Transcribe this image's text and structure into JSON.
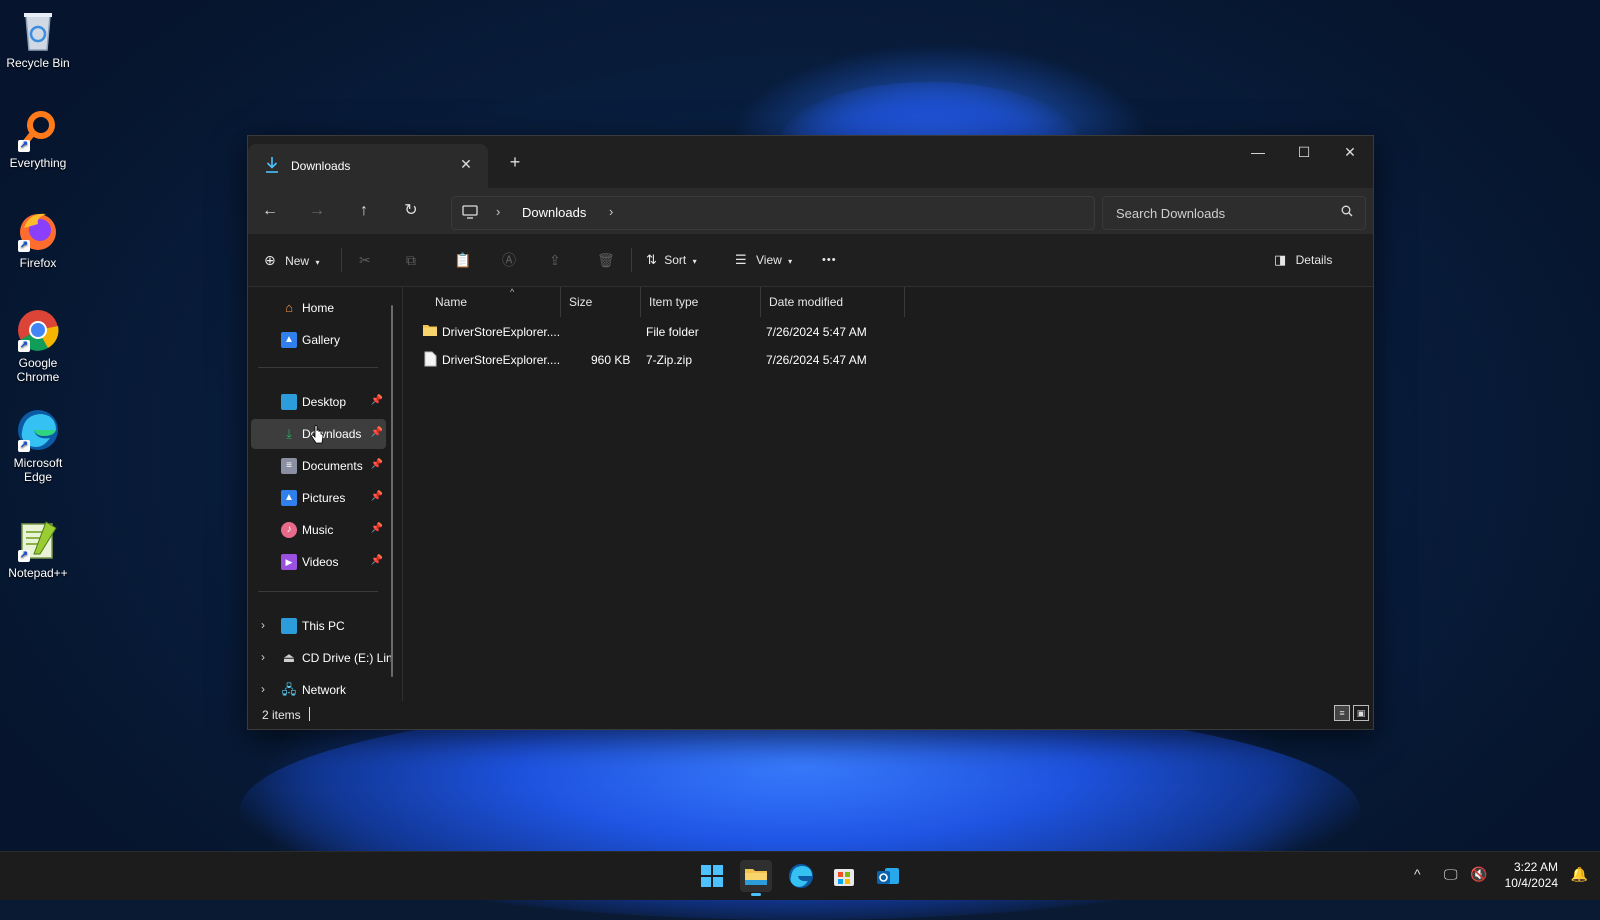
{
  "desktop": {
    "icons": [
      {
        "label": "Recycle Bin"
      },
      {
        "label": "Everything"
      },
      {
        "label": "Firefox"
      },
      {
        "label": "Google Chrome"
      },
      {
        "label": "Microsoft Edge"
      },
      {
        "label": "Notepad++"
      }
    ]
  },
  "window": {
    "tab_title": "Downloads",
    "address": {
      "crumb": "Downloads"
    },
    "search": {
      "placeholder": "Search Downloads"
    },
    "toolbar": {
      "new_label": "New",
      "sort_label": "Sort",
      "view_label": "View",
      "more_label": "•••",
      "details_label": "Details"
    },
    "sidebar": {
      "quick": [
        {
          "label": "Home"
        },
        {
          "label": "Gallery"
        }
      ],
      "pinned": [
        {
          "label": "Desktop"
        },
        {
          "label": "Downloads"
        },
        {
          "label": "Documents"
        },
        {
          "label": "Pictures"
        },
        {
          "label": "Music"
        },
        {
          "label": "Videos"
        }
      ],
      "locations": [
        {
          "label": "This PC"
        },
        {
          "label": "CD Drive (E:) Lin"
        },
        {
          "label": "Network"
        }
      ]
    },
    "columns": {
      "name": "Name",
      "size": "Size",
      "type": "Item type",
      "date": "Date modified"
    },
    "files": [
      {
        "name": "DriverStoreExplorer....",
        "size": "",
        "type": "File folder",
        "date": "7/26/2024 5:47 AM"
      },
      {
        "name": "DriverStoreExplorer....",
        "size": "960 KB",
        "type": "7-Zip.zip",
        "date": "7/26/2024 5:47 AM"
      }
    ],
    "status": {
      "items": "2 items"
    }
  },
  "taskbar": {
    "time": "3:22 AM",
    "date": "10/4/2024"
  },
  "colors": {
    "accent": "#4cc2ff",
    "folder": "#f2c14e",
    "selected": "#3d3d3d"
  }
}
